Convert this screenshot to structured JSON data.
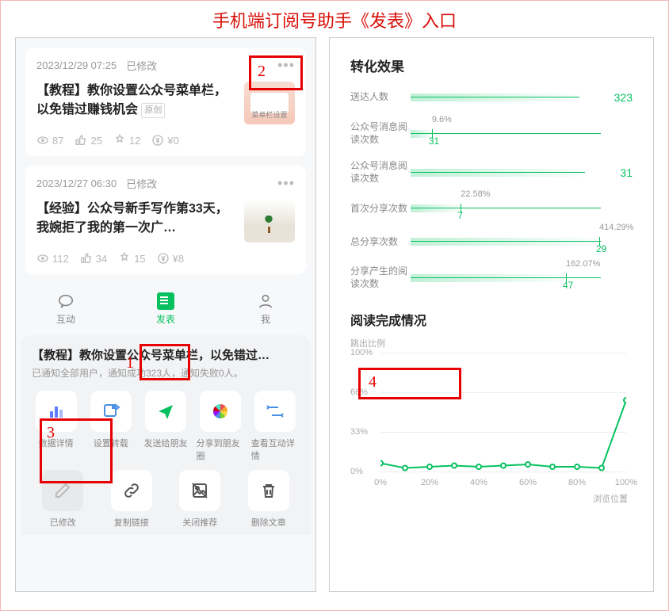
{
  "title": "手机端订阅号助手《发表》入口",
  "annotations": {
    "a1": "1",
    "a2": "2",
    "a3": "3",
    "a4": "4"
  },
  "articles": [
    {
      "date": "2023/12/29 07:25",
      "status": "已修改",
      "title": "【教程】教你设置公众号菜单栏，以免错过赚钱机会",
      "orig_tag": "原创",
      "thumb_text": "菜单栏设置",
      "views": "87",
      "likes": "25",
      "wows": "12",
      "earn": "¥0"
    },
    {
      "date": "2023/12/27 06:30",
      "status": "已修改",
      "title": "【经验】公众号新手写作第33天，我婉拒了我的第一次广…",
      "views": "112",
      "likes": "34",
      "wows": "15",
      "earn": "¥8"
    }
  ],
  "tabs": {
    "interact": "互动",
    "publish": "发表",
    "me": "我"
  },
  "sheet": {
    "title": "【教程】教你设置公众号菜单栏，以免错过…",
    "sub": "已通知全部用户，通知成功323人，通知失败0人。",
    "row1": [
      {
        "key": "data",
        "label": "数据详情"
      },
      {
        "key": "repost",
        "label": "设置转载"
      },
      {
        "key": "send",
        "label": "发送给朋友"
      },
      {
        "key": "moments",
        "label": "分享到朋友圈"
      },
      {
        "key": "detail",
        "label": "查看互动详情"
      }
    ],
    "row2": [
      {
        "key": "edited",
        "label": "已修改"
      },
      {
        "key": "copy",
        "label": "复制链接"
      },
      {
        "key": "close",
        "label": "关闭推荐"
      },
      {
        "key": "delete",
        "label": "删除文章"
      }
    ]
  },
  "conversion": {
    "heading": "转化效果",
    "metrics": [
      {
        "label": "送达人数",
        "value": "323",
        "bar_full": true
      },
      {
        "label": "公众号消息阅读次数",
        "pct": "9.6%",
        "pctval": "31",
        "tick_pct": 9.6
      },
      {
        "label": "公众号消息阅读次数",
        "value": "31",
        "bar_full": true
      },
      {
        "label": "首次分享次数",
        "pct": "22.58%",
        "pctval": "7",
        "tick_pct": 22.58
      },
      {
        "label": "总分享次数",
        "pct": "414.29%",
        "pctval": "29",
        "tick_pct": 85
      },
      {
        "label": "分享产生的阅读次数",
        "pct": "162.07%",
        "pctval": "47",
        "tick_pct": 70
      }
    ]
  },
  "reading": {
    "heading": "阅读完成情况",
    "ylabel": "跳出比例",
    "xtitle": "浏览位置",
    "y_ticks": [
      "100%",
      "66%",
      "33%",
      "0%"
    ],
    "x_ticks": [
      "0%",
      "20%",
      "40%",
      "60%",
      "80%",
      "100%"
    ]
  },
  "chart_data": {
    "type": "line",
    "title": "阅读完成情况",
    "xlabel": "浏览位置",
    "ylabel": "跳出比例",
    "ylim": [
      0,
      100
    ],
    "x": [
      0,
      10,
      20,
      30,
      40,
      50,
      60,
      70,
      80,
      90,
      100
    ],
    "values": [
      7,
      3,
      4,
      5,
      4,
      5,
      6,
      4,
      4,
      3,
      60
    ]
  }
}
